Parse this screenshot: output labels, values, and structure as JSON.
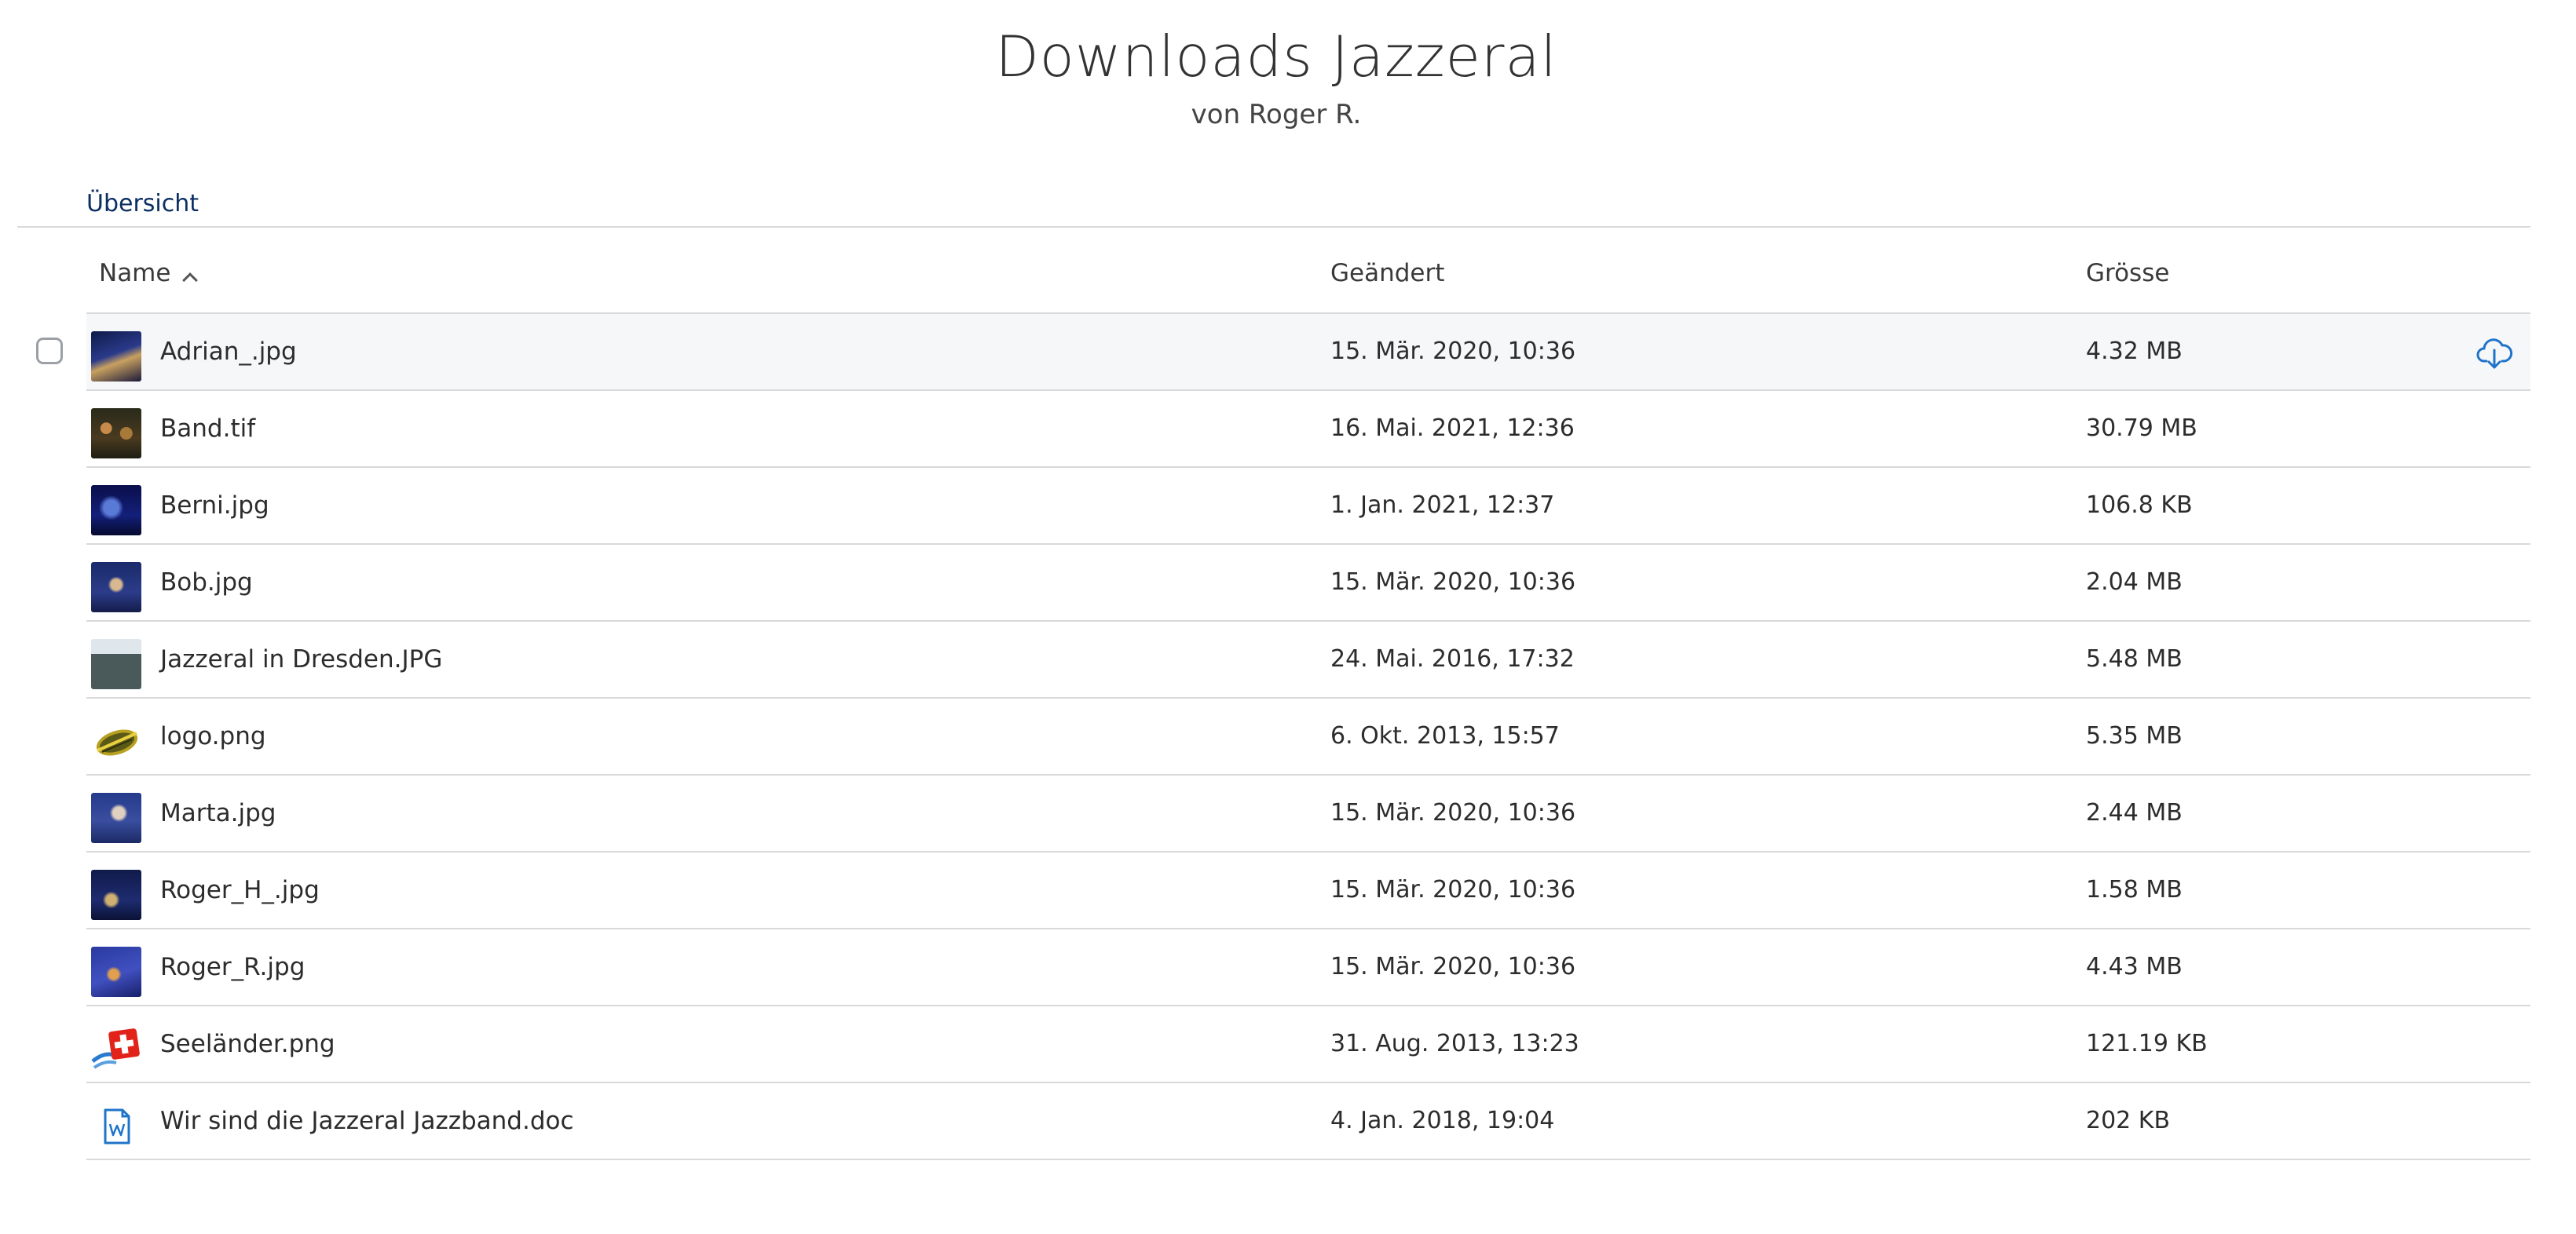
{
  "header": {
    "title": "Downloads Jazzeral",
    "subtitle": "von Roger R."
  },
  "breadcrumb": "Übersicht",
  "columns": {
    "name": "Name",
    "changed": "Geändert",
    "size": "Grösse"
  },
  "files": [
    {
      "name": "Adrian_.jpg",
      "date": "15. Mär. 2020, 10:36",
      "size": "4.32 MB",
      "thumb": "photo"
    },
    {
      "name": "Band.tif",
      "date": "16. Mai. 2021, 12:36",
      "size": "30.79 MB",
      "thumb": "photo"
    },
    {
      "name": "Berni.jpg",
      "date": "1. Jan. 2021, 12:37",
      "size": "106.8 KB",
      "thumb": "photo"
    },
    {
      "name": "Bob.jpg",
      "date": "15. Mär. 2020, 10:36",
      "size": "2.04 MB",
      "thumb": "photo"
    },
    {
      "name": "Jazzeral in Dresden.JPG",
      "date": "24. Mai. 2016, 17:32",
      "size": "5.48 MB",
      "thumb": "photo"
    },
    {
      "name": "logo.png",
      "date": "6. Okt. 2013, 15:57",
      "size": "5.35 MB",
      "thumb": "logo"
    },
    {
      "name": "Marta.jpg",
      "date": "15. Mär. 2020, 10:36",
      "size": "2.44 MB",
      "thumb": "photo"
    },
    {
      "name": "Roger_H_.jpg",
      "date": "15. Mär. 2020, 10:36",
      "size": "1.58 MB",
      "thumb": "photo"
    },
    {
      "name": "Roger_R.jpg",
      "date": "15. Mär. 2020, 10:36",
      "size": "4.43 MB",
      "thumb": "photo"
    },
    {
      "name": "Seeländer.png",
      "date": "31. Aug. 2013, 13:23",
      "size": "121.19 KB",
      "thumb": "swiss-flag"
    },
    {
      "name": "Wir sind die Jazzeral Jazzband.doc",
      "date": "4. Jan. 2018, 19:04",
      "size": "202 KB",
      "thumb": "word-doc-icon"
    }
  ],
  "icons": {
    "sort": "chevron-up-icon",
    "download": "cloud-download-icon",
    "checkbox": "checkbox-icon"
  },
  "colors": {
    "accent": "#1f74c9",
    "breadcrumb": "#0b2e63"
  }
}
